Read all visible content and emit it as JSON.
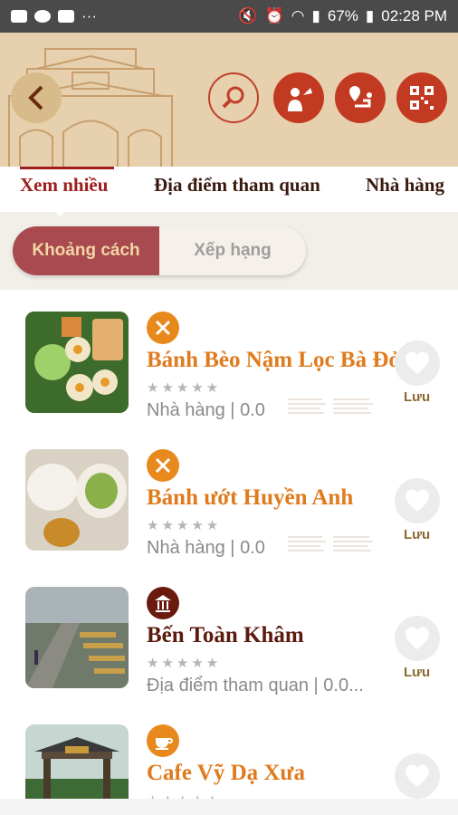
{
  "status_bar": {
    "battery": "67%",
    "time": "02:28 PM"
  },
  "header": {
    "actions": [
      "back-icon",
      "search-icon",
      "guide-icon",
      "route-icon",
      "qr-code-icon"
    ]
  },
  "tabs": [
    {
      "label": "Xem nhiều",
      "active": true
    },
    {
      "label": "Địa điểm tham quan",
      "active": false
    },
    {
      "label": "Nhà hàng",
      "active": false
    }
  ],
  "sort": {
    "options": [
      "Khoảng cách",
      "Xếp hạng"
    ],
    "selected": "Khoảng cách"
  },
  "colors": {
    "accent_red": "#c33a22",
    "title_orange": "#e07b1d",
    "title_brown": "#5a1a0e",
    "segment_active": "#a84a4f",
    "gold": "#8a6a2f"
  },
  "places": [
    {
      "name": "Bánh Bèo Nậm Lọc Bà Đỏ",
      "category": "Nhà hàng",
      "rating": "0.0",
      "icon": "fork-knife-icon",
      "save": "Lưu"
    },
    {
      "name": "Bánh ướt  Huyền Anh",
      "category": "Nhà hàng",
      "rating": "0.0",
      "icon": "fork-knife-icon",
      "save": "Lưu"
    },
    {
      "name": "Bến Toàn Khâm",
      "category": "Địa điểm tham quan",
      "rating": "0.0...",
      "icon": "landmark-icon",
      "save": "Lưu"
    },
    {
      "name": "Cafe Vỹ Dạ Xưa",
      "category": "",
      "rating": "",
      "icon": "coffee-cup-icon",
      "save": ""
    }
  ]
}
